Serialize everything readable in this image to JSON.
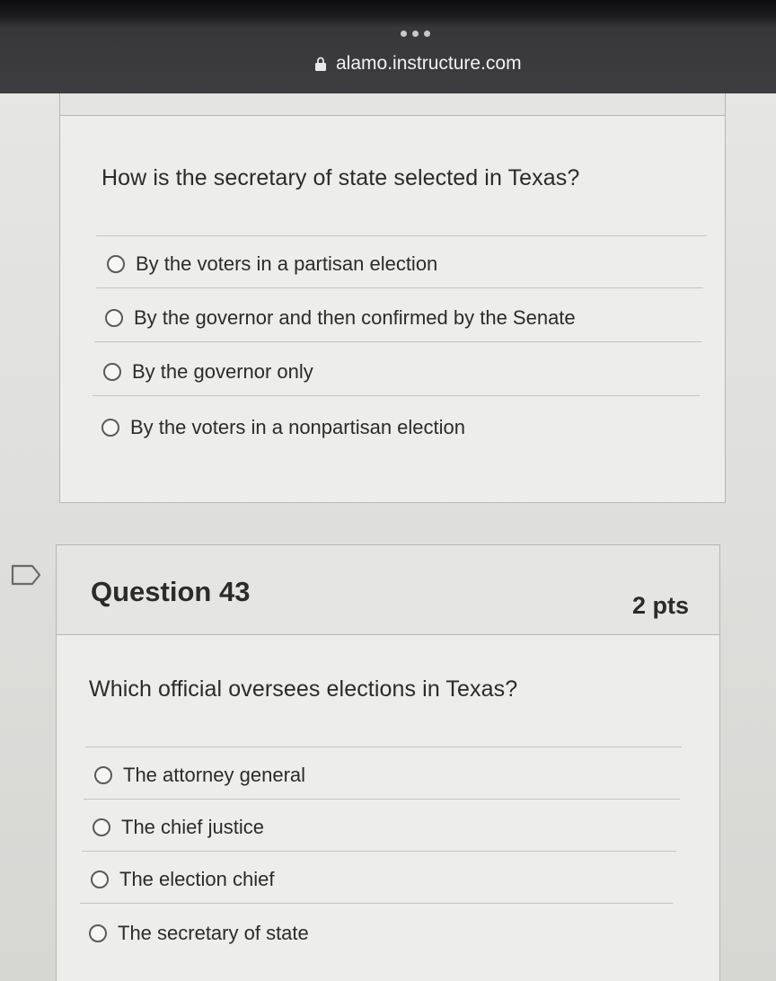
{
  "browser": {
    "url": "alamo.instructure.com"
  },
  "q42": {
    "question": "How is the secretary of state selected in Texas?",
    "options": [
      "By the voters in a partisan election",
      "By the governor and then confirmed by the Senate",
      "By the governor only",
      "By the voters in a nonpartisan election"
    ]
  },
  "q43": {
    "title": "Question 43",
    "points": "2 pts",
    "question": "Which official oversees elections in Texas?",
    "options": [
      "The attorney general",
      "The chief justice",
      "The election chief",
      "The secretary of state"
    ]
  },
  "icons": {
    "lock": "lock-icon",
    "bookmark": "bookmark-flag-icon",
    "tabs": "more-dots-icon"
  }
}
